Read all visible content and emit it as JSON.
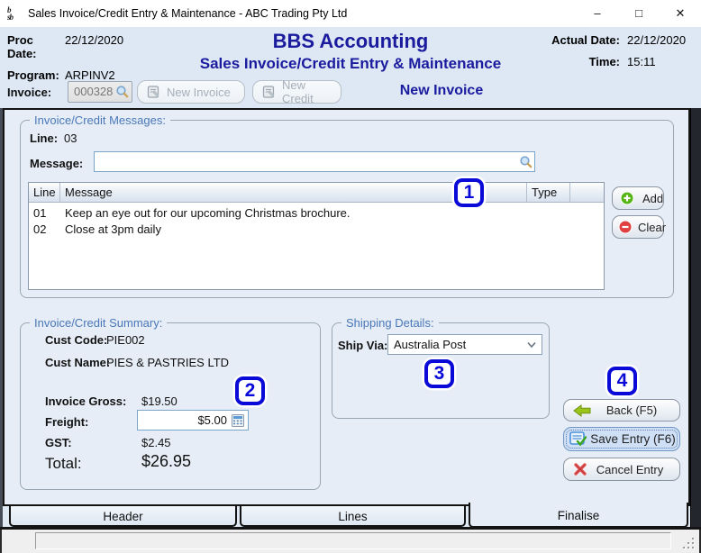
{
  "window": {
    "title": "Sales Invoice/Credit Entry & Maintenance - ABC Trading Pty Ltd",
    "app_icon_text": "bsb",
    "controls": {
      "minimize": "–",
      "maximize": "□",
      "close": "✕"
    }
  },
  "header": {
    "proc_date_label": "Proc Date:",
    "proc_date": "22/12/2020",
    "program_label": "Program:",
    "program": "ARPINV2",
    "app_title": "BBS Accounting",
    "screen_title": "Sales Invoice/Credit Entry & Maintenance",
    "actual_date_label": "Actual Date:",
    "actual_date": "22/12/2020",
    "time_label": "Time:",
    "time": "15:11",
    "invoice_label": "Invoice:",
    "invoice_number": "000328",
    "new_invoice_button": "New Invoice",
    "new_credit_button": "New Credit",
    "mode_title": "New Invoice"
  },
  "messages": {
    "legend": "Invoice/Credit Messages:",
    "line_label": "Line:",
    "line_value": "03",
    "message_label": "Message:",
    "message_value": "",
    "table": {
      "columns": [
        "Line",
        "Message",
        "Type"
      ],
      "rows": [
        {
          "line": "01",
          "message": "Keep an eye out for our upcoming Christmas brochure.",
          "type": ""
        },
        {
          "line": "02",
          "message": "Close at 3pm daily",
          "type": ""
        }
      ]
    },
    "add_button": "Add",
    "clear_button": "Clear"
  },
  "summary": {
    "legend": "Invoice/Credit Summary:",
    "cust_code_label": "Cust Code:",
    "cust_code": "PIE002",
    "cust_name_label": "Cust Name:",
    "cust_name": "PIES & PASTRIES LTD",
    "invoice_gross_label": "Invoice Gross:",
    "invoice_gross": "$19.50",
    "freight_label": "Freight:",
    "freight_value": "$5.00",
    "gst_label": "GST:",
    "gst": "$2.45",
    "total_label": "Total:",
    "total": "$26.95"
  },
  "shipping": {
    "legend": "Shipping Details:",
    "ship_via_label": "Ship Via:",
    "ship_via_selected": "Australia Post"
  },
  "actions": {
    "back_button": "Back (F5)",
    "save_button": "Save Entry (F6)",
    "cancel_button": "Cancel Entry"
  },
  "tabs": [
    {
      "label": "Header",
      "active": false
    },
    {
      "label": "Lines",
      "active": false
    },
    {
      "label": "Finalise",
      "active": true
    }
  ],
  "annotations": [
    {
      "number": "1"
    },
    {
      "number": "2"
    },
    {
      "number": "3"
    },
    {
      "number": "4"
    }
  ],
  "colors": {
    "heading_navy": "#1b1b9e",
    "legend_blue": "#4a78b8",
    "annotation_blue": "#0a0ad8",
    "add_green": "#55b515",
    "clear_red": "#e04040",
    "back_arrow_green": "#9ac41c",
    "cancel_red": "#e25050",
    "save_icon_blue": "#4a90d9",
    "header_bg": "#dde8f4",
    "page_bg": "#e6edf6"
  }
}
